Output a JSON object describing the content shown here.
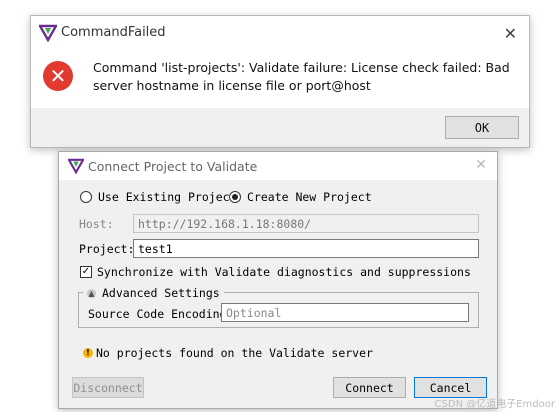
{
  "error_dialog": {
    "title": "CommandFailed",
    "close_glyph": "✕",
    "icon_glyph": "✕",
    "message": "Command 'list-projects': Validate failure: License check failed: Bad server hostname in license file or port@host",
    "ok_label": "OK"
  },
  "connect_dialog": {
    "title": "Connect Project to Validate",
    "close_glyph": "✕",
    "radio_existing": "Use Existing Project",
    "radio_new": "Create New Project",
    "selected_radio": "Create New Project",
    "host_label": "Host:",
    "host_value": "http://192.168.1.18:8080/",
    "project_label": "Project:",
    "project_value": "test1",
    "sync_label": "Synchronize with Validate diagnostics and suppressions",
    "sync_checked": true,
    "advanced_label": "Advanced Settings",
    "encoding_label": "Source Code Encoding:",
    "encoding_placeholder": "Optional",
    "warning_text": "No projects found on the Validate server",
    "disconnect_label": "Disconnect",
    "connect_label": "Connect",
    "cancel_label": "Cancel"
  },
  "colors": {
    "error_red": "#e23a2e",
    "logo_purple": "#6a2c91",
    "warning_yellow": "#f5b400",
    "default_button_border": "#0078d7"
  },
  "watermark": "CSDN @亿道电子Emdoor"
}
